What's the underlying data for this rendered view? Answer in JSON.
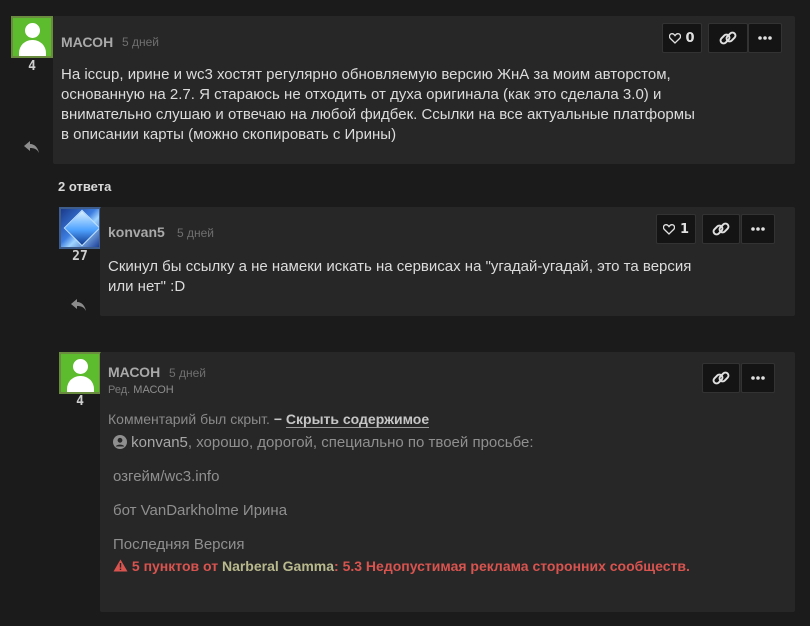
{
  "post1": {
    "author": "МАСОН",
    "time": "5 дней",
    "level": "4",
    "likes": "0",
    "body_lines": [
      "На iccup, ирине и wc3 хостят регулярно обновляемую версию ЖнА за моим авторстом,",
      "основанную на 2.7. Я стараюсь не отходить от духа оригинала (как это сделала 3.0) и",
      "внимательно слушаю и отвечаю на любой фидбек. Ссылки на все актуальные платформы",
      "в описании карты (можно скопировать с Ирины)"
    ]
  },
  "replies_count": "2 ответа",
  "reply1": {
    "author": "konvan5",
    "time": "5 дней",
    "level": "27",
    "likes": "1",
    "body_lines": [
      "Скинул бы ссылку а не намеки искать на сервисах на \"угадай-угадай, это та версия",
      "или нет\" :D"
    ]
  },
  "reply2": {
    "author": "МАСОН",
    "time": "5 дней",
    "level": "4",
    "edited_prefix": "Ред.",
    "edited_by": "МАСОН",
    "hidden_note": "Комментарий был скрыт.",
    "hide_toggle_dash": "−",
    "hide_toggle": "Скрыть содержимое",
    "mention_user": "konvan5",
    "mention_rest": ", хорошо, дорогой, специально по твоей просьбе:",
    "line_site": "озгейм/wc3.info",
    "line_bot": "бот VanDarkholme Ирина",
    "line_version": "Последняя Версия",
    "warning_points": "5 пунктов от",
    "warning_user": "Narberal Gamma",
    "warning_reason": ": 5.3 Недопустимая реклама сторонних сообществ."
  },
  "icons": {
    "like": "heart-icon",
    "link": "link-icon",
    "more": "ellipsis-icon",
    "reply": "reply-arrow-icon",
    "user": "user-icon",
    "warning": "warning-triangle-icon"
  },
  "colors": {
    "background": "#1b1b1b",
    "card": "#272727",
    "avatar_green": "#5dbb2e",
    "warning_red": "#d9534f"
  }
}
